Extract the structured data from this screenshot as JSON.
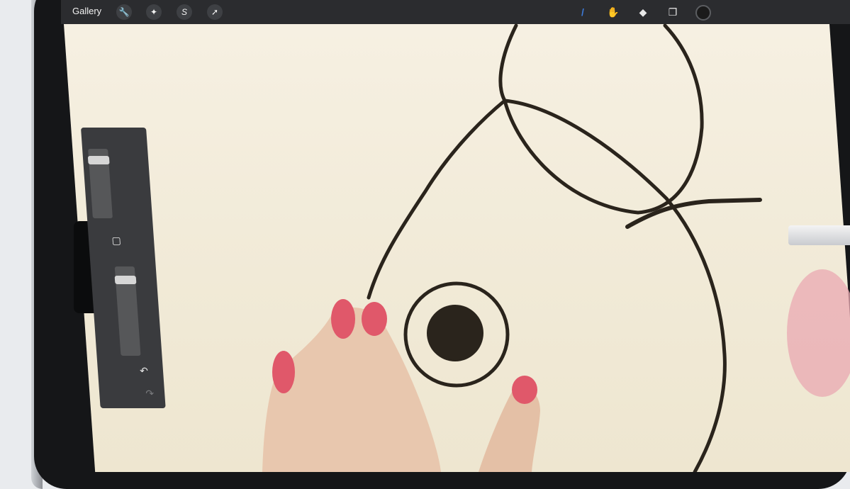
{
  "toolbar": {
    "gallery_label": "Gallery",
    "left_tools": [
      {
        "name": "actions",
        "icon": "wrench-icon",
        "glyph": "🔧"
      },
      {
        "name": "adjustments",
        "icon": "magic-wand-icon",
        "glyph": "✦"
      },
      {
        "name": "selection",
        "icon": "selection-s-icon",
        "glyph": "S"
      },
      {
        "name": "transform",
        "icon": "arrow-cursor-icon",
        "glyph": "➚"
      }
    ],
    "right_tools": [
      {
        "name": "brush",
        "icon": "brush-icon",
        "glyph": "/",
        "active": true
      },
      {
        "name": "smudge",
        "icon": "smudge-icon",
        "glyph": "✋"
      },
      {
        "name": "eraser",
        "icon": "eraser-icon",
        "glyph": "◆"
      },
      {
        "name": "layers",
        "icon": "layers-icon",
        "glyph": "❐"
      }
    ],
    "color": "#1b1b1b",
    "accent": "#3d7bd9"
  },
  "sidebar": {
    "brush_size_level": 0.1,
    "brush_opacity_level": 0.1,
    "modify_button_icon": "square-icon",
    "undo_icon": "undo-icon",
    "redo_icon": "redo-icon"
  },
  "canvas": {
    "background": "#f3ecdc",
    "stroke_color": "#2a241c"
  }
}
